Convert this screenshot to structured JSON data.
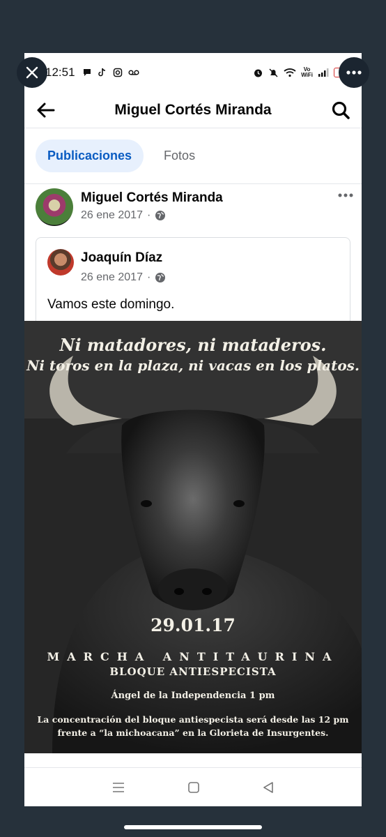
{
  "status_bar": {
    "time": "12:51",
    "battery": "14",
    "volte_top": "Vo",
    "volte_bottom": "WiFi"
  },
  "header": {
    "title": "Miguel Cortés Miranda",
    "back_icon": "arrow-left-icon",
    "search_icon": "search-icon"
  },
  "tabs": [
    {
      "label": "Publicaciones",
      "active": true
    },
    {
      "label": "Fotos",
      "active": false
    }
  ],
  "post": {
    "author": "Miguel Cortés Miranda",
    "date": "26 ene 2017",
    "privacy_icon": "globe-icon",
    "shared": {
      "author": "Joaquín Díaz",
      "date": "26 ene 2017",
      "text": "Vamos este domingo."
    },
    "poster": {
      "line1": "Ni matadores, ni mataderos.",
      "line2": "Ni toros en la plaza, ni vacas en los platos.",
      "date": "29.01.17",
      "marcha": "MARCHA ANTITAURINA",
      "bloque": "BLOQUE ANTIESPECISTA",
      "angel": "Ángel de la Independencia 1 pm",
      "concentracion1": "La concentración del bloque antiespecista será desde las 12 pm",
      "concentracion2": "frente a “la michoacana” en la  Glorieta de Insurgentes."
    }
  },
  "colors": {
    "accent": "#0a5cc2",
    "tab_active_bg": "#e7f0fd",
    "backdrop": "#26313b"
  }
}
